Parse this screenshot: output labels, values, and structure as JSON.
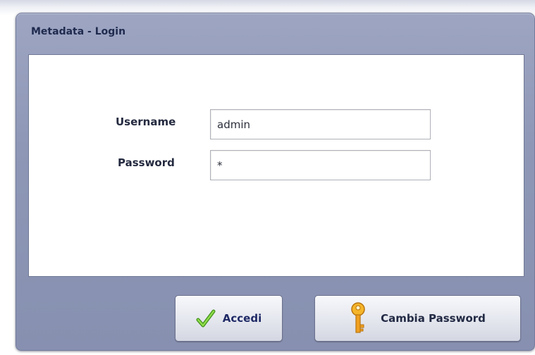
{
  "dialog": {
    "title": "Metadata - Login"
  },
  "form": {
    "username_label": "Username",
    "username_value": "admin",
    "password_label": "Password",
    "password_value": "*"
  },
  "buttons": {
    "login_label": "Accedi",
    "login_icon": "checkmark-icon",
    "change_password_label": "Cambia Password",
    "change_password_icon": "key-icon"
  },
  "colors": {
    "dialog_frame": "#8e97b6",
    "title_text": "#1f2a4e",
    "checkmark_green": "#5ab82a",
    "key_gold": "#f0a020"
  }
}
